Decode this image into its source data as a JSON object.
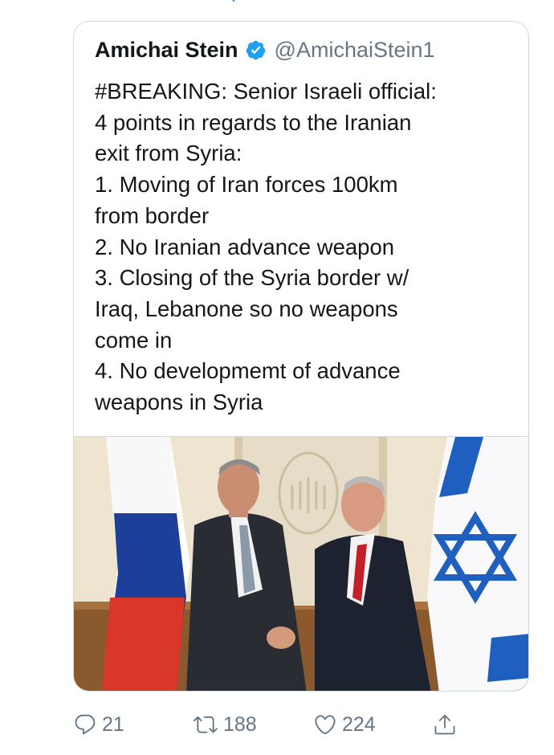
{
  "tweet": {
    "author_name": "Amichai Stein",
    "handle": "@AmichaiStein1",
    "verified": true,
    "text_lines": [
      "#BREAKING: Senior Israeli official:",
      "4 points in regards to the Iranian",
      "exit from Syria:",
      "1. Moving of Iran forces 100km",
      "from border",
      "2. No Iranian advance weapon",
      "3. Closing of the Syria border w/",
      "Iraq, Lebanone so no weapons",
      "come in",
      "4. No developmemt of advance",
      "weapons in Syria"
    ]
  },
  "actions": {
    "replies": "21",
    "retweets": "188",
    "likes": "224"
  },
  "icons": [
    "verified-badge-icon",
    "reply-icon",
    "retweet-icon",
    "like-icon",
    "share-icon"
  ],
  "colors": {
    "verified_blue": "#1da1f2",
    "text": "#14171a",
    "secondary": "#657786",
    "border": "#cfd9de"
  }
}
